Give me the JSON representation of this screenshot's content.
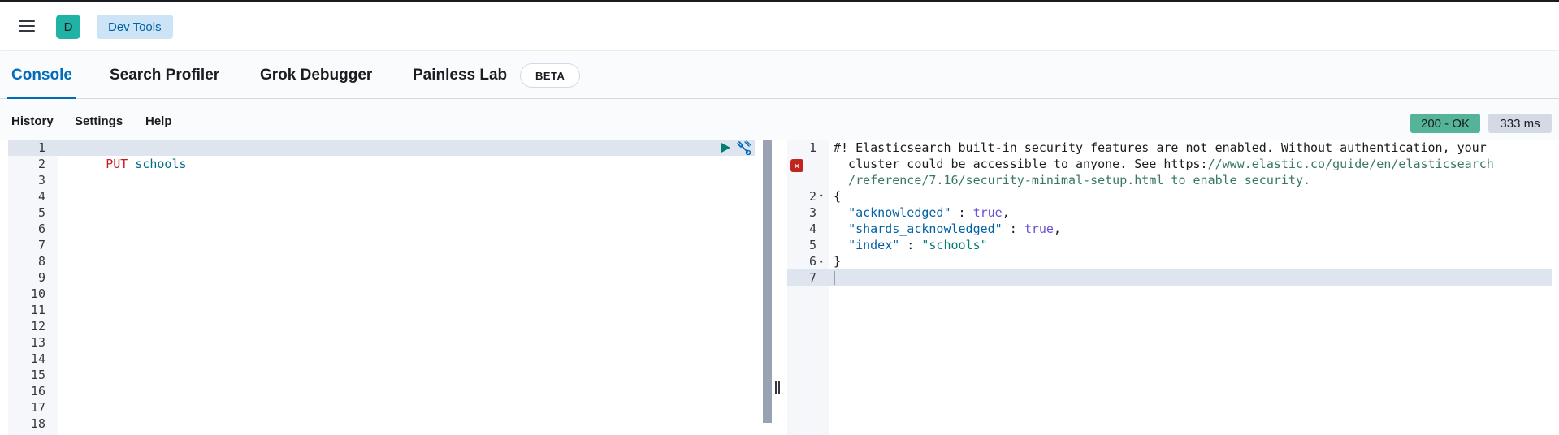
{
  "header": {
    "space_initial": "D",
    "breadcrumb": "Dev Tools"
  },
  "tabs": [
    {
      "label": "Console",
      "active": true
    },
    {
      "label": "Search Profiler",
      "active": false
    },
    {
      "label": "Grok Debugger",
      "active": false
    },
    {
      "label": "Painless Lab",
      "active": false
    }
  ],
  "beta_label": "BETA",
  "sub_menu": {
    "history": "History",
    "settings": "Settings",
    "help": "Help"
  },
  "status": {
    "code": "200 - OK",
    "time": "333 ms",
    "ok_color": "#54b399"
  },
  "request": {
    "method": "PUT",
    "url": "schools",
    "line_numbers": [
      "1",
      "2",
      "3",
      "4",
      "5",
      "6",
      "7",
      "8",
      "9",
      "10",
      "11",
      "12",
      "13",
      "14",
      "15",
      "16",
      "17",
      "18"
    ]
  },
  "response": {
    "line_numbers": [
      "1",
      "",
      "",
      "2",
      "3",
      "4",
      "5",
      "6",
      "7"
    ],
    "warning_line1": "#! Elasticsearch built-in security features are not enabled. Without authentication, your",
    "warning_line2_prefix": "  cluster could be accessible to anyone. See https:",
    "warning_line2_url": "//www.elastic.co/guide/en/elasticsearch",
    "warning_line3": "  /reference/7.16/security-minimal-setup.html to enable security.",
    "open_brace": "{",
    "close_brace": "}",
    "acknowledged_key": "\"acknowledged\"",
    "acknowledged_val": "true",
    "shards_key": "\"shards_acknowledged\"",
    "shards_val": "true",
    "index_key": "\"index\"",
    "index_val": "\"schools\""
  },
  "icons": {
    "menu": "hamburger-icon",
    "run": "play-icon",
    "wrench": "wrench-icon",
    "error": "error-icon"
  }
}
